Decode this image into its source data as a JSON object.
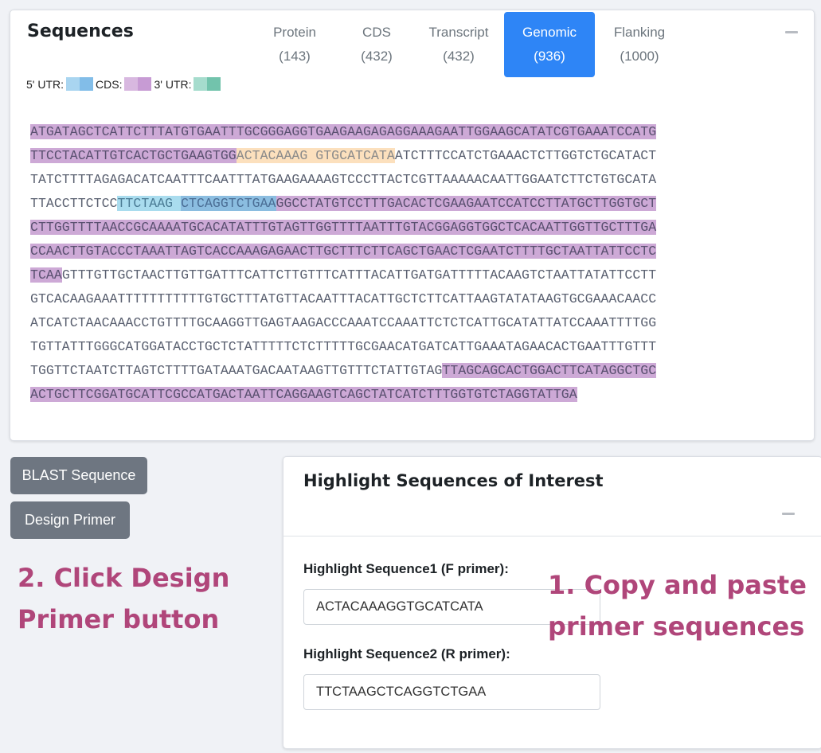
{
  "sequences": {
    "title": "Sequences",
    "tabs": [
      {
        "name": "Protein",
        "count": "(143)"
      },
      {
        "name": "CDS",
        "count": "(432)"
      },
      {
        "name": "Transcript",
        "count": "(432)"
      },
      {
        "name": "Genomic",
        "count": "(936)"
      },
      {
        "name": "Flanking",
        "count": "(1000)"
      }
    ],
    "active_tab": "Genomic",
    "legend": {
      "utr5": "5' UTR:",
      "cds": "CDS:",
      "utr3": "3' UTR:"
    },
    "colors": {
      "utr5": [
        "#a9d5f0",
        "#82bde8"
      ],
      "cds": [
        "#d8b8e0",
        "#c79bd4"
      ],
      "utr3": [
        "#a6dccd",
        "#72c3ac"
      ],
      "cds_highlight": "#cda9d6",
      "primer_f_highlight": "#fce0bd",
      "primer_r_highlight": "#a9dcee",
      "active_tab": "#2e85f6"
    },
    "lines": [
      [
        {
          "t": "ATGATAGCTCATTCTTTATGTGAATTTGCGGGAGGTGAAGAAGAGAGGAAAGAATTGGAAGCATATCGTGAAATCCATG",
          "c": "cds"
        }
      ],
      [
        {
          "t": "TTCCTACATTGTCACTGCTGAAGTGG",
          "c": "cds"
        },
        {
          "t": "ACTACAAAG",
          "c": "hl1"
        },
        {
          "t": "GTGCATCATA",
          "c": "hl1"
        },
        {
          "t": "ATCTTTCCATCTGAAACTCTTGGTCTGCATACT",
          "c": ""
        }
      ],
      [
        {
          "t": "TATCTTTTAGAGACATCAATTTCAATTTATGAAGAAAAGTCCCTTACTCGTTAAAAACAATTGGAATCTTCTGTGCATA",
          "c": ""
        }
      ],
      [
        {
          "t": "TTACCTTCTCC",
          "c": ""
        },
        {
          "t": "TTCTAAG",
          "c": "utr5"
        },
        {
          "t": "CTCAGGTCTGAA",
          "c": "utr5b"
        },
        {
          "t": "GGCCTATGTCCTTTGACACTCGAAGAATCCATCCTTATGCTTGGTGCT",
          "c": "cds"
        }
      ],
      [
        {
          "t": "CTTGGTTTTAACCGCAAAATGCACATATTTGTAGTTGGTTTTAATTTGTACGGAGGTGGCTCACAATTGGTTGCTTTGA",
          "c": "cds"
        }
      ],
      [
        {
          "t": "CCAACTTGTACCCTAAATTAGTCACCAAAGAGAACTTGCTTTCTTCAGCTGAACTCGAATCTTTTGCTAATTATTCCTC",
          "c": "cds"
        }
      ],
      [
        {
          "t": "TCAA",
          "c": "cds"
        },
        {
          "t": "GTTTGTTGCTAACTTGTTGATTTCATTCTTGTTTCATTTACATTGATGATTTTTACAAGTCTAATTATATTCCTT",
          "c": ""
        }
      ],
      [
        {
          "t": "GTCACAAGAAATTTTTTTTTTTGTGCTTTATGTTACAATTTACATTGCTCTTCATTAAGTATATAAGTGCGAAACAACC",
          "c": ""
        }
      ],
      [
        {
          "t": "ATCATCTAACAAACCTGTTTTGCAAGGTTGAGTAAGACCCAAATCCAAATTCTCTCATTGCATATTATCCAAATTTTGG",
          "c": ""
        }
      ],
      [
        {
          "t": "TGTTATTTGGGCATGGATACCTGCTCTATTTTTCTCTTTTTGCGAACATGATCATTGAAATAGAACACTGAATTTGTTT",
          "c": ""
        }
      ],
      [
        {
          "t": "TGGTTCTAATCTTAGTCTTTTGATAAATGACAATAAGTTGTTTCTATTGTAG",
          "c": ""
        },
        {
          "t": "TTAGCAGCACTGGACTTCATAGGCTGC",
          "c": "cds"
        }
      ],
      [
        {
          "t": "ACTGCTTCGGATGCATTCGCCATGACTAATTCAGGAAGTCAGCTATCATCTTTGGTGTCTAGGTATTGA",
          "c": "cds"
        }
      ]
    ]
  },
  "actions": {
    "blast_label": "BLAST Sequence",
    "design_label": "Design Primer"
  },
  "annotations": {
    "step2_line1": "2. Click Design",
    "step2_line2": "Primer button",
    "step1_line1": "1. Copy and paste",
    "step1_line2": "primer sequences",
    "color": "#b0467a"
  },
  "highlight": {
    "title": "Highlight Sequences of Interest",
    "field1_label": "Highlight Sequence1 (F primer):",
    "field1_value": "ACTACAAAGGTGCATCATA",
    "field2_label": "Highlight Sequence2 (R primer):",
    "field2_value": "TTCTAAGCTCAGGTCTGAA"
  }
}
